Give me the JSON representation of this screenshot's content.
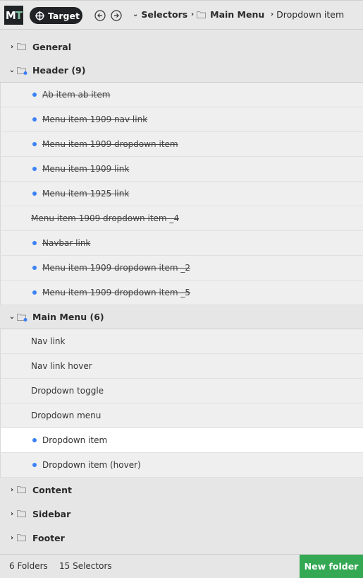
{
  "toolbar": {
    "logo_m": "M",
    "logo_t": "T",
    "target_label": "Target",
    "breadcrumbs": [
      {
        "label": "Selectors",
        "bold": true
      },
      {
        "label": "Main Menu",
        "bold": true
      },
      {
        "label": "Dropdown item",
        "bold": false
      }
    ]
  },
  "tree": {
    "folders": [
      {
        "name": "General",
        "expanded": false
      },
      {
        "name": "Header (9)",
        "expanded": true,
        "items": [
          {
            "label": "Ab item ab item",
            "dot": true,
            "strike": true
          },
          {
            "label": "Menu item 1909 nav link",
            "dot": true,
            "strike": true
          },
          {
            "label": "Menu item 1909 dropdown item",
            "dot": true,
            "strike": true
          },
          {
            "label": "Menu item 1909 link",
            "dot": true,
            "strike": true
          },
          {
            "label": "Menu item 1925 link",
            "dot": true,
            "strike": true
          },
          {
            "label": "Menu item 1909 dropdown item _4",
            "dot": false,
            "strike": true
          },
          {
            "label": "Navbar link",
            "dot": true,
            "strike": true
          },
          {
            "label": "Menu item 1909 dropdown item _2",
            "dot": true,
            "strike": true
          },
          {
            "label": "Menu item 1909 dropdown item _5",
            "dot": true,
            "strike": true
          }
        ]
      },
      {
        "name": "Main Menu (6)",
        "expanded": true,
        "items": [
          {
            "label": "Nav link",
            "dot": false,
            "strike": false
          },
          {
            "label": "Nav link hover",
            "dot": false,
            "strike": false
          },
          {
            "label": "Dropdown toggle",
            "dot": false,
            "strike": false
          },
          {
            "label": "Dropdown menu",
            "dot": false,
            "strike": false
          },
          {
            "label": "Dropdown item",
            "dot": true,
            "strike": false,
            "selected": true
          },
          {
            "label": "Dropdown item (hover)",
            "dot": true,
            "strike": false
          }
        ]
      },
      {
        "name": "Content",
        "expanded": false
      },
      {
        "name": "Sidebar",
        "expanded": false
      },
      {
        "name": "Footer",
        "expanded": false
      }
    ]
  },
  "footer": {
    "folders_count": "6 Folders",
    "selectors_count": "15 Selectors",
    "new_folder_label": "New folder"
  },
  "colors": {
    "accent_dot": "#3b82f6",
    "new_folder_bg": "#34a853",
    "dark": "#1f2326"
  }
}
